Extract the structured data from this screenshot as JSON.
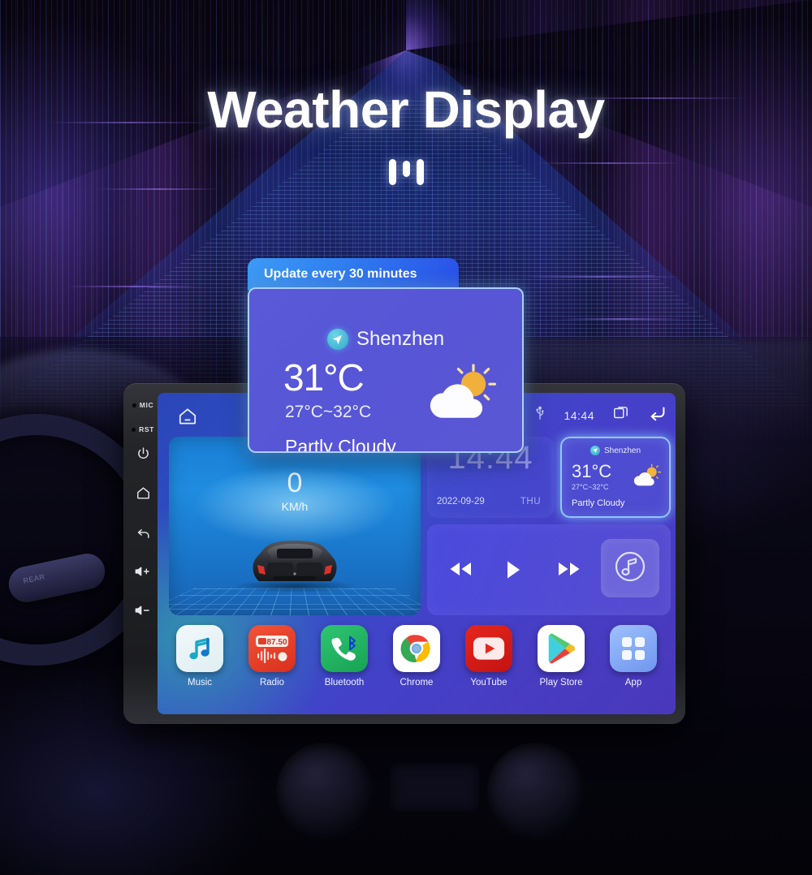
{
  "page": {
    "title": "Weather Display"
  },
  "callout": {
    "tab_label": "Update every 30 minutes",
    "location": "Shenzhen",
    "location_icon": "navigation-arrow-icon",
    "temperature": "31°C",
    "range": "27°C~32°C",
    "condition": "Partly Cloudy",
    "weather_icon": "sun-behind-cloud-icon"
  },
  "head_unit": {
    "bezel": {
      "items": [
        {
          "name": "mic",
          "label": "MIC",
          "type": "dot-label"
        },
        {
          "name": "reset",
          "label": "RST",
          "type": "dot-label"
        },
        {
          "name": "power",
          "label": "",
          "type": "icon",
          "icon": "power-icon"
        },
        {
          "name": "home",
          "label": "",
          "type": "icon",
          "icon": "home-icon"
        },
        {
          "name": "back",
          "label": "",
          "type": "icon",
          "icon": "back-arrow-icon"
        },
        {
          "name": "volume-up",
          "label": "+",
          "type": "icon",
          "icon": "volume-up-icon"
        },
        {
          "name": "volume-down",
          "label": "−",
          "type": "icon",
          "icon": "volume-down-icon"
        }
      ]
    },
    "screen": {
      "home_icon": "home-icon",
      "status_bar": {
        "usb_icon": "usb-icon",
        "time": "14:44",
        "recents_icon": "recent-apps-icon",
        "back_icon": "back-arrow-icon"
      },
      "widgets": {
        "car": {
          "speed": "0",
          "unit": "KM/h"
        },
        "clock": {
          "time": "14:44",
          "date": "2022-09-29",
          "weekday": "THU"
        },
        "weather": {
          "location": "Shenzhen",
          "location_icon": "navigation-arrow-icon",
          "temperature": "31°C",
          "range": "27°C~32°C",
          "condition": "Partly Cloudy",
          "weather_icon": "sun-behind-cloud-icon"
        },
        "media": {
          "prev_icon": "rewind-icon",
          "play_icon": "play-icon",
          "next_icon": "fast-forward-icon",
          "art_icon": "music-note-circle-icon"
        }
      },
      "dock": [
        {
          "label": "Music",
          "icon": "music-note-icon"
        },
        {
          "label": "Radio",
          "icon": "radio-icon",
          "frequency": "87.50"
        },
        {
          "label": "Bluetooth",
          "icon": "bluetooth-phone-icon"
        },
        {
          "label": "Chrome",
          "icon": "chrome-icon"
        },
        {
          "label": "YouTube",
          "icon": "youtube-icon"
        },
        {
          "label": "Play Store",
          "icon": "play-store-icon"
        },
        {
          "label": "App",
          "icon": "app-grid-icon"
        }
      ]
    }
  },
  "colors": {
    "accent_blue": "#2f7df0",
    "card_purple": "#5a5ad8",
    "highlight_border": "#a0cfff",
    "screen_blue": "#3250c8",
    "radio_red": "#e8402a",
    "bluetooth_green": "#22b060",
    "youtube_red": "#e21d1d"
  }
}
